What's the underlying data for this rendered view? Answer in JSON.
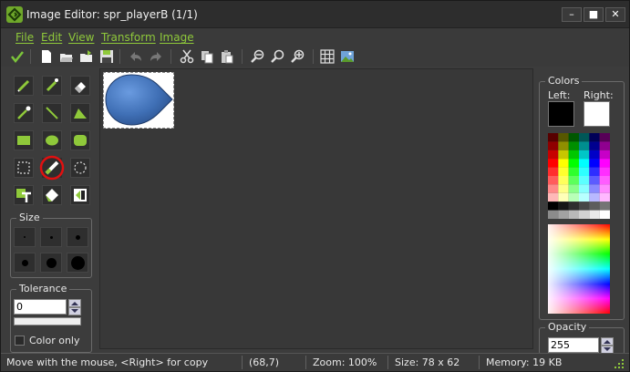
{
  "window": {
    "title": "Image Editor: spr_playerB (1/1)",
    "buttons": [
      "–",
      "■",
      "✕"
    ]
  },
  "menu": {
    "items": [
      "File",
      "Edit",
      "View",
      "Transform",
      "Image"
    ]
  },
  "toolbar": {
    "icons": [
      "confirm-check-icon",
      "new-icon",
      "open-icon",
      "open-folder-icon",
      "save-icon",
      "undo-icon",
      "redo-icon",
      "cut-icon",
      "copy-icon",
      "paste-icon",
      "zoom-out-icon",
      "zoom-reset-icon",
      "zoom-in-icon",
      "grid-icon",
      "image-preview-icon"
    ]
  },
  "tools": {
    "items": [
      "pencil",
      "spray",
      "eraser",
      "color-picker",
      "line",
      "polygon",
      "rectangle",
      "ellipse",
      "rounded-rectangle",
      "select-rectangle",
      "select-magic-wand",
      "select-ellipse",
      "text",
      "fill",
      "flip"
    ],
    "highlighted": "select-magic-wand"
  },
  "size": {
    "label": "Size"
  },
  "tolerance": {
    "label": "Tolerance",
    "value": "0",
    "color_only_label": "Color only"
  },
  "colors": {
    "label": "Colors",
    "left_label": "Left:",
    "right_label": "Right:",
    "left_color": "#000000",
    "right_color": "#ffffff"
  },
  "opacity": {
    "label": "Opacity",
    "value": "255"
  },
  "status": {
    "hint": "Move with the mouse, <Right> for copy",
    "coords": "(68,7)",
    "zoom": "Zoom: 100%",
    "size": "Size: 78 x 62",
    "memory": "Memory: 19 KB"
  },
  "accent_color": "#8fc93a"
}
